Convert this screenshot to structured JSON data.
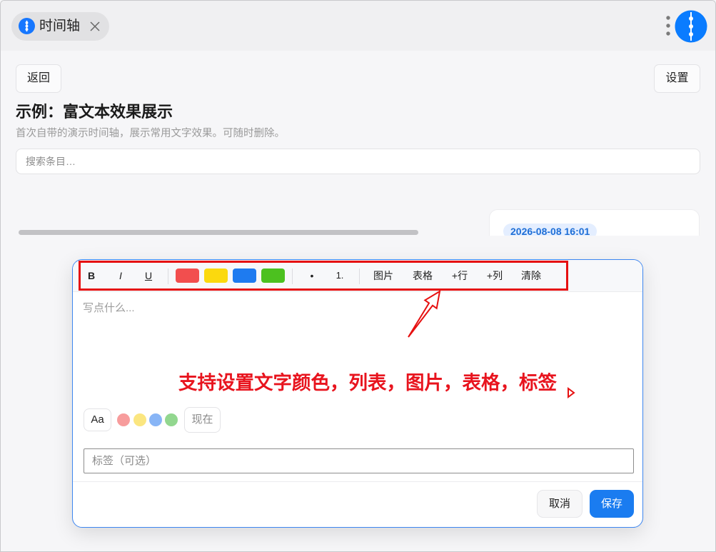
{
  "app": {
    "tab": {
      "title": "时间轴",
      "icon": "timeline-icon",
      "close_icon": "close-icon"
    },
    "menu_icon": "more-vertical-icon",
    "logo_icon": "timeline-logo-icon"
  },
  "header": {
    "back_label": "返回",
    "settings_label": "设置",
    "title": "示例：富文本效果展示",
    "subtitle": "首次自带的演示时间轴，展示常用文字效果。可随时删除。"
  },
  "search": {
    "placeholder": "搜索条目…"
  },
  "timeline": {
    "entries": [
      {
        "timestamp": "2026-08-08 16:01"
      }
    ]
  },
  "editor": {
    "toolbar": {
      "bold": "B",
      "italic": "I",
      "underline": "U",
      "text_colors": [
        "#f24e4e",
        "#fbd90e",
        "#1e7bf0",
        "#4cc11f"
      ],
      "bullet_list": "•",
      "numbered_list": "1.",
      "insert_image": "图片",
      "insert_table": "表格",
      "add_row": "+行",
      "add_column": "+列",
      "clear": "清除"
    },
    "content_placeholder": "写点什么...",
    "font_size_label": "Aa",
    "highlight_colors": [
      "#f79c9c",
      "#fbe680",
      "#88b5f6",
      "#92d78f"
    ],
    "now_label": "现在",
    "tag_placeholder": "标签（可选）",
    "cancel_label": "取消",
    "save_label": "保存"
  },
  "annotation": {
    "text": "支持设置文字颜色，列表，图片，表格，标签",
    "color": "#e8141e"
  },
  "colors": {
    "accent": "#1a7cf0",
    "modal_border": "#3d86f0",
    "background": "#f6f6f8"
  }
}
